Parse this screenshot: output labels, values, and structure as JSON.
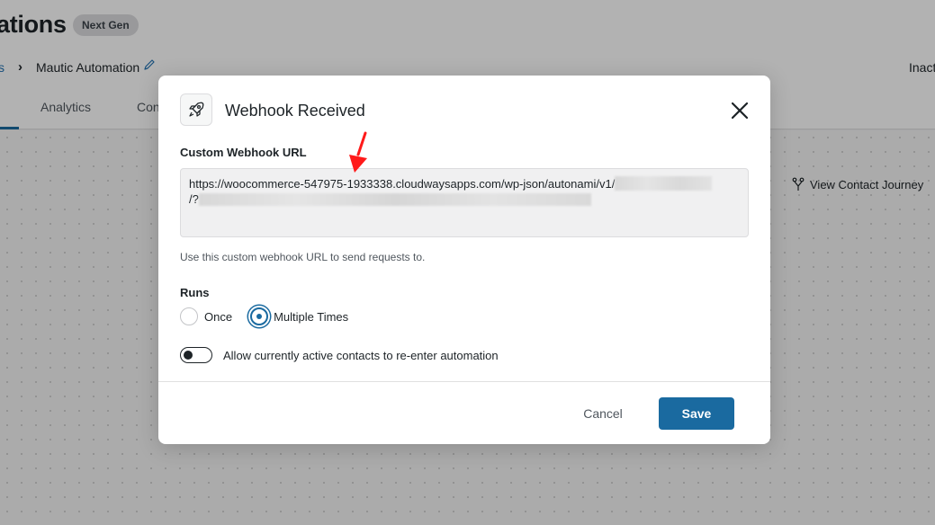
{
  "background": {
    "page_title_fragment": "ations",
    "badge": "Next Gen",
    "breadcrumb": {
      "previous": "s",
      "current": "Mautic Automation"
    },
    "status_fragment": "Inact",
    "tabs": [
      "Analytics",
      "Con"
    ],
    "view_journey": "View Contact Journey"
  },
  "modal": {
    "title": "Webhook Received",
    "icon": "rocket-icon",
    "url_label": "Custom Webhook URL",
    "url_value_line1": "https://woocommerce-547975-1933338.cloudwaysapps.com/wp-json/autonami/v1/",
    "url_value_line2": "/?",
    "url_help": "Use this custom webhook URL to send requests to.",
    "runs_label": "Runs",
    "run_options": [
      {
        "label": "Once",
        "checked": false
      },
      {
        "label": "Multiple Times",
        "checked": true
      }
    ],
    "reenter_toggle": {
      "label": "Allow currently active contacts to re-enter automation",
      "on": false
    },
    "cancel_label": "Cancel",
    "save_label": "Save"
  },
  "colors": {
    "primary": "#1a6aa0",
    "annotation_arrow": "#ff1a1a"
  }
}
